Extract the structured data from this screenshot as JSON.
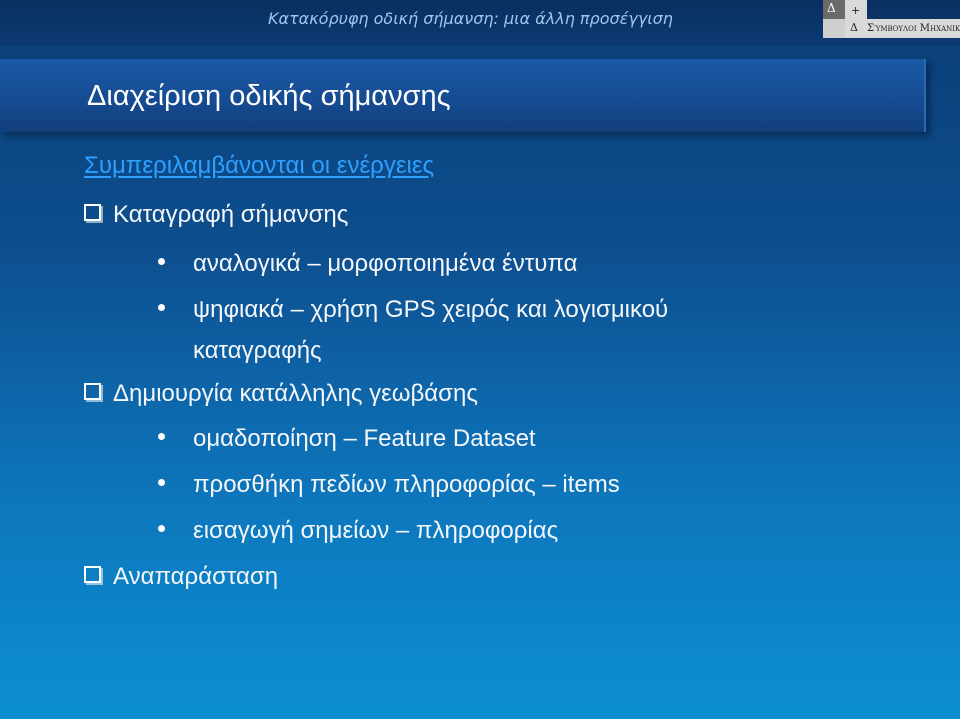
{
  "header": {
    "subtitle": "Κατακόρυφη οδική σήμανση: μια άλλη προσέγγιση",
    "logo": {
      "glyph_top": "Δ",
      "glyph_plus": "+",
      "glyph_bottom": "Δ",
      "brand_text": "Σύμβουλοι Μηχανικοί"
    }
  },
  "slide": {
    "title": "Διαχείριση οδικής σήμανσης",
    "heading": "Συμπεριλαμβάνονται οι ενέργειες",
    "items": [
      {
        "label": "Καταγραφή σήμανσης",
        "subitems": [
          "αναλογικά – μορφοποιημένα έντυπα",
          "ψηφιακά – χρήση GPS χειρός και λογισμικού",
          "καταγραφής"
        ]
      },
      {
        "label": "Δημιουργία κατάλληλης γεωβάσης",
        "subitems": [
          "ομαδοποίηση – Feature Dataset",
          "προσθήκη πεδίων πληροφορίας – items",
          "εισαγωγή σημείων – πληροφορίας"
        ]
      },
      {
        "label": "Αναπαράσταση",
        "subitems": []
      }
    ]
  },
  "colors": {
    "heading": "#2ea0ff",
    "background_top": "#0b3d76",
    "background_bottom": "#0c8fd1"
  }
}
